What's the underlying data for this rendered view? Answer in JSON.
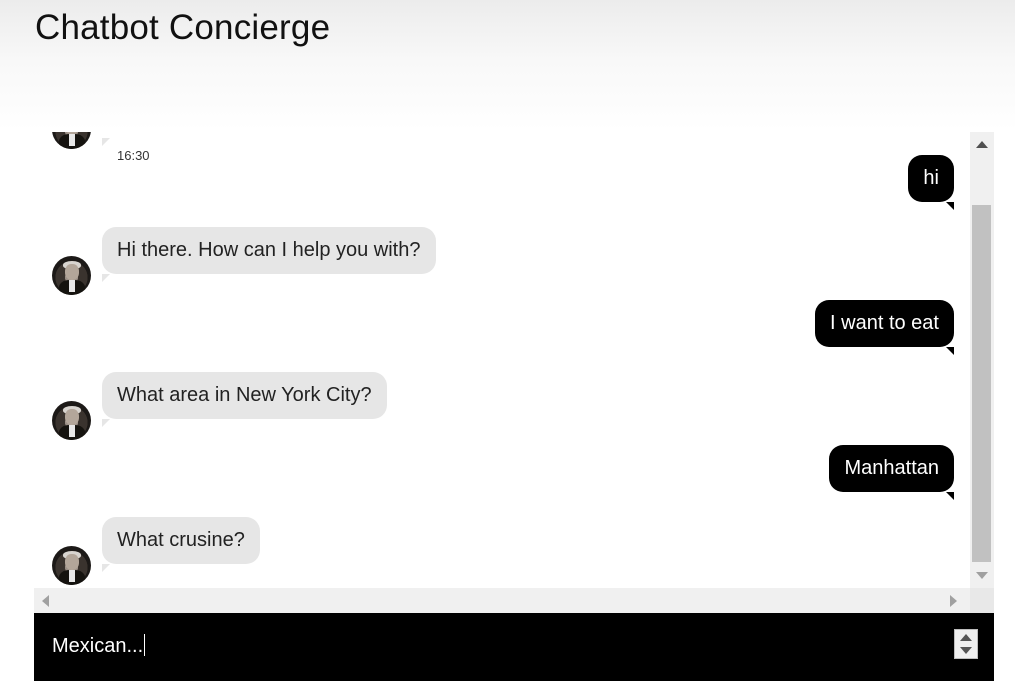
{
  "app": {
    "title": "Chatbot Concierge"
  },
  "chat": {
    "partial_top_time": "16:30",
    "messages": [
      {
        "sender": "user",
        "text": "hi"
      },
      {
        "sender": "bot",
        "text": "Hi there. How can I help you with?"
      },
      {
        "sender": "user",
        "text": "I want to eat"
      },
      {
        "sender": "bot",
        "text": "What area in New York City?"
      },
      {
        "sender": "user",
        "text": "Manhattan"
      },
      {
        "sender": "bot",
        "text": "What crusine?"
      }
    ]
  },
  "input": {
    "value": "Mexican..."
  },
  "icons": {
    "bot_avatar": "bot-avatar-photo",
    "scroll_up": "triangle-up-icon",
    "scroll_down": "triangle-down-icon",
    "scroll_left": "triangle-left-icon",
    "scroll_right": "triangle-right-icon",
    "spinner": "spinner-arrows-icon"
  },
  "colors": {
    "user_bubble": "#000000",
    "bot_bubble": "#e6e6e6",
    "input_bar": "#000000"
  }
}
